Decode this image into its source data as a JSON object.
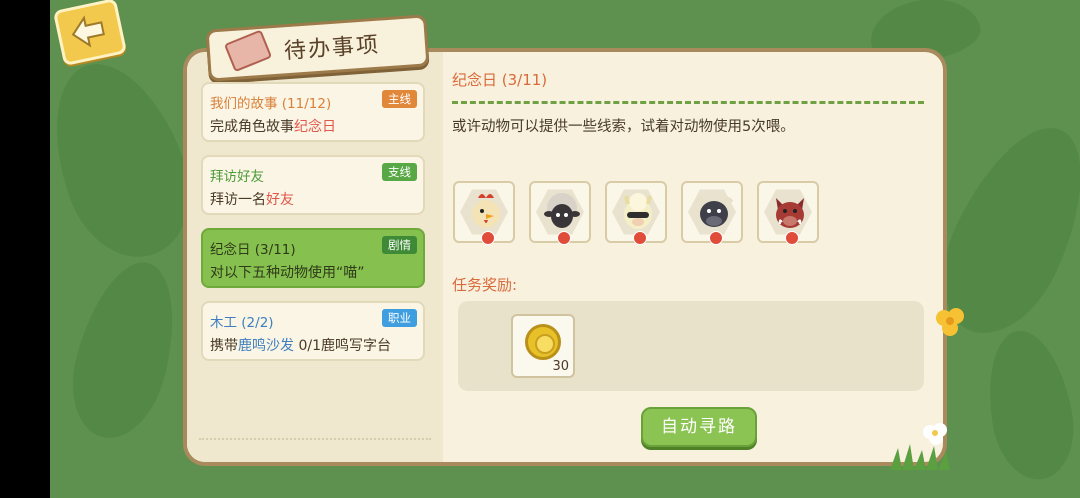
{
  "colors": {
    "main_tag": "#e0873a",
    "side_tag": "#58a845",
    "story_tag": "#3f8a36",
    "job_tag": "#3f9ee0",
    "highlight": "#e0564a"
  },
  "icons": {
    "back": "back-arrow-icon",
    "title": "ticket-icon",
    "reward": "gold-coin-icon"
  },
  "header": {
    "title": "待办事项"
  },
  "quests": [
    {
      "title": "我们的故事 (11/12)",
      "tag": "主线",
      "desc": "完成角色故事",
      "desc_highlight": "纪念日",
      "title_color": "#d9803a"
    },
    {
      "title": "拜访好友",
      "tag": "支线",
      "desc": "拜访一名",
      "desc_highlight": "好友",
      "title_color": "#4e9a3a"
    },
    {
      "title": "纪念日 (3/11)",
      "tag": "剧情",
      "desc": "对以下五种动物使用“喵”",
      "title_color": "#2f3a1a"
    },
    {
      "title": "木工 (2/2)",
      "tag": "职业",
      "desc_prefix": "携带",
      "desc_highlight": "鹿鸣沙发",
      "desc": " 0/1鹿鸣写字台",
      "title_color": "#3f7fbf"
    }
  ],
  "detail": {
    "title": "纪念日 (3/11)",
    "description": "或许动物可以提供一些线索，试着对动物使用5次喂。",
    "animals": [
      "chicken-icon",
      "black-sheep-icon",
      "alpaca-icon",
      "bull-icon",
      "boar-icon"
    ],
    "reward_label": "任务奖励:",
    "reward": {
      "icon": "gold-coin-icon",
      "count": "30"
    },
    "auto_path_label": "自动寻路"
  }
}
